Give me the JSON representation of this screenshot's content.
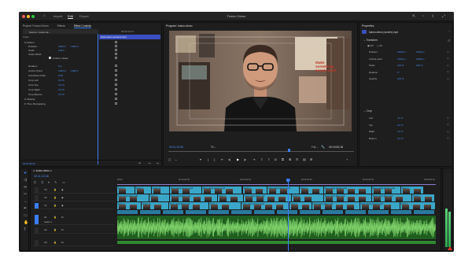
{
  "app": {
    "nav": {
      "home_icon": "home-icon",
      "import": "Import",
      "edit": "Edit",
      "export": "Export"
    },
    "document_title": "Fusion Demo",
    "window_icons": [
      "quick-export-icon",
      "progress-icon",
      "share-icon",
      "fullscreen-icon"
    ]
  },
  "source_panel": {
    "tabs": [
      "Project: Fusion Demo",
      "Effects",
      "Effect Controls"
    ],
    "source_label": "Source • fusion-de...",
    "clip_label": "fusion-demo • fusion-d...",
    "timecode_ruler": "00:00:19:13",
    "clip_bar_label": "fusion-demo (screen).mp4",
    "video_label": "Video",
    "rows": [
      {
        "label": "fx  Motion",
        "v1": "",
        "v2": ""
      },
      {
        "label": "Position",
        "v1": "1000.0",
        "v2": "1000.0"
      },
      {
        "label": "Scale",
        "v1": "100.0",
        "v2": ""
      },
      {
        "label": "Scale Width",
        "v1": "",
        "v2": ""
      },
      {
        "label": "Uniform Scale",
        "v1": "",
        "v2": ""
      },
      {
        "label": "Rotation",
        "v1": "0.0",
        "v2": ""
      },
      {
        "label": "Anchor Point",
        "v1": "1000.0",
        "v2": "1000.0"
      },
      {
        "label": "Anti-flicker Filter",
        "v1": "0.00",
        "v2": ""
      },
      {
        "label": "Crop Left",
        "v1": "0.0 %",
        "v2": ""
      },
      {
        "label": "Crop Top",
        "v1": "0.0 %",
        "v2": ""
      },
      {
        "label": "Crop Right",
        "v1": "0.0 %",
        "v2": ""
      },
      {
        "label": "Crop Bottom",
        "v1": "0.0 %",
        "v2": ""
      },
      {
        "label": "fx  Opacity",
        "v1": "",
        "v2": ""
      },
      {
        "label": "fx  Time Remapping",
        "v1": "",
        "v2": ""
      }
    ],
    "footer_timecode": "00:01:08:00"
  },
  "program_panel": {
    "title": "Program: fusion-demo",
    "timecode_left": "00:11:10:08",
    "fit": "Fit",
    "full": "Full",
    "timecode_right": "00:19:53:18",
    "poster_text": "Make something people want"
  },
  "properties_panel": {
    "title": "Properties",
    "clip_name": "fusion-demo (screen).mp4",
    "transform_label": "Transform",
    "fill_label": "Fill",
    "fit_label": "Fit",
    "rows": [
      {
        "label": "Position",
        "v1": "1000 px",
        "v2": "1080 px"
      },
      {
        "label": "Anchor point",
        "v1": "1000 px",
        "v2": "1080 px"
      },
      {
        "label": "Scale",
        "v1": "100 %",
        "v2": "100 %"
      },
      {
        "label": "Rotation",
        "v1": "0°",
        "v2": ""
      },
      {
        "label": "Opacity",
        "v1": "100 %",
        "v2": ""
      }
    ],
    "crop_label": "Crop",
    "crop_rows": [
      {
        "label": "Left",
        "v1": "0.0 %"
      },
      {
        "label": "Top",
        "v1": "0.0 %"
      },
      {
        "label": "Right",
        "v1": "0.0 %"
      },
      {
        "label": "Bottom",
        "v1": "0.0 %"
      }
    ]
  },
  "timeline": {
    "sequence_tab": "fusion-demo",
    "timecode": "00:11:10:08",
    "ruler_labels": [
      "00:00",
      "00:10:00:00",
      "00:20:00:00",
      "00:30:00:00",
      "00:40:00:00",
      "00:50:00:00"
    ],
    "tracks": [
      "V3",
      "V2",
      "V1",
      "A1",
      "A2",
      "A3"
    ],
    "audio_track_name": "Audio 1",
    "clip_name_v2": "fusion-demo (screen).mp4",
    "clip_name_v1": "fusion-demo (face).mp4",
    "clip_short": "fusion-d",
    "clip_short2": "Fusion Fe"
  },
  "colors": {
    "accent": "#3b7df5",
    "video_clip": "#3aa6c8",
    "audio_clip": "#2e8a2e",
    "timeline_purple": "#a88cf5"
  }
}
